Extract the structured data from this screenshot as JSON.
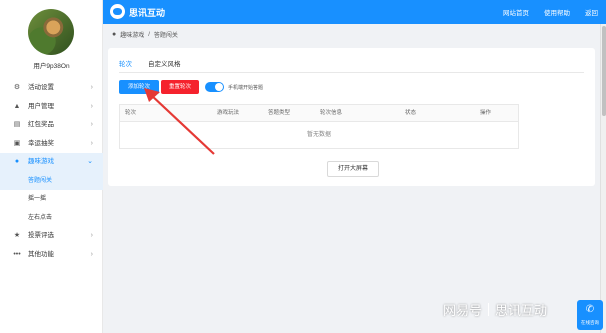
{
  "header": {
    "app_title": "思讯互动",
    "links": [
      "网站首页",
      "使用帮助",
      "返回"
    ],
    "accent": "#1890ff"
  },
  "sidebar": {
    "username": "用户9p38On",
    "items": [
      {
        "label": "活动设置",
        "icon": "gear-people-icon",
        "chevron": "›"
      },
      {
        "label": "用户管理",
        "icon": "user-icon",
        "chevron": "›"
      },
      {
        "label": "红包奖品",
        "icon": "gift-icon",
        "chevron": "›"
      },
      {
        "label": "幸运抽奖",
        "icon": "lottery-icon",
        "chevron": "›"
      },
      {
        "label": "趣味游戏",
        "icon": "game-icon",
        "chevron": "⌄"
      },
      {
        "label": "答题闯关",
        "sub": true
      },
      {
        "label": "摇一摇",
        "sub": true
      },
      {
        "label": "左右点击",
        "sub": true
      },
      {
        "label": "投票评选",
        "icon": "star-icon",
        "chevron": "›"
      },
      {
        "label": "其他功能",
        "icon": "more-icon",
        "chevron": "›"
      }
    ]
  },
  "breadcrumb": {
    "items": [
      "趣味游戏",
      "答题闯关"
    ],
    "separator": "/"
  },
  "tabs": [
    "轮次",
    "自定义风格"
  ],
  "toolbar": {
    "add_label": "添加轮次",
    "reset_label": "重置轮次",
    "switch_label": "手机端开始答题"
  },
  "table": {
    "columns": [
      "轮次",
      "游戏玩法",
      "答题类型",
      "轮次信息",
      "状态",
      "操作"
    ],
    "empty_text": "暂无数据"
  },
  "open_screen_label": "打开大屏幕",
  "watermark": {
    "left": "网易号",
    "right": "思讯互动"
  },
  "consult_label": "在线咨询"
}
